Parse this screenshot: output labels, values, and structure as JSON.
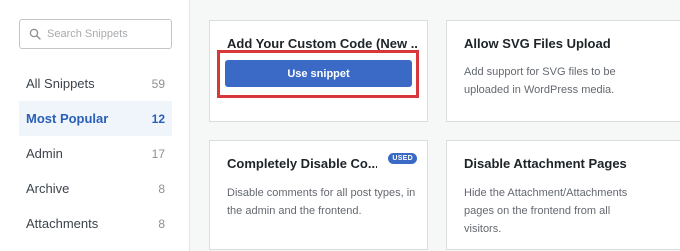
{
  "sidebar": {
    "search_placeholder": "Search Snippets",
    "categories": [
      {
        "label": "All Snippets",
        "count": "59"
      },
      {
        "label": "Most Popular",
        "count": "12"
      },
      {
        "label": "Admin",
        "count": "17"
      },
      {
        "label": "Archive",
        "count": "8"
      },
      {
        "label": "Attachments",
        "count": "8"
      }
    ]
  },
  "cards": [
    {
      "title": "Add Your Custom Code (New ...",
      "button_label": "Use snippet"
    },
    {
      "title": "Allow SVG Files Upload",
      "description": "Add support for SVG files to be uploaded in WordPress media."
    },
    {
      "title": "Completely Disable Co...",
      "badge": "USED",
      "description": "Disable comments for all post types, in the admin and the frontend."
    },
    {
      "title": "Disable Attachment Pages",
      "description": "Hide the Attachment/Attachments pages on the frontend from all visitors."
    }
  ],
  "colors": {
    "accent": "#3a69c6",
    "highlight": "#d8383a",
    "active_bg": "#f0f4fb"
  }
}
